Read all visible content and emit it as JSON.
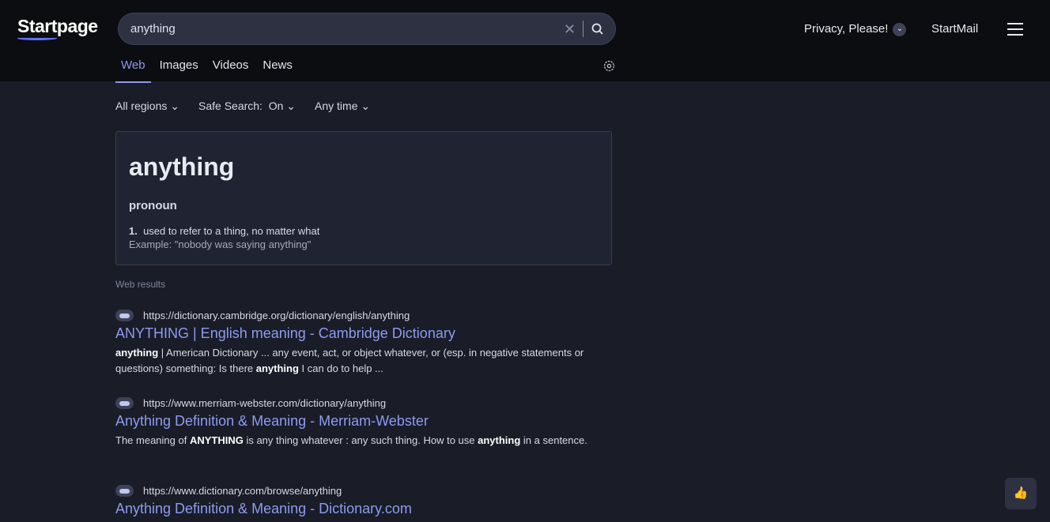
{
  "header": {
    "logo": "Startpage",
    "query": "anything",
    "privacy": "Privacy, Please!",
    "startmail": "StartMail"
  },
  "tabs": [
    "Web",
    "Images",
    "Videos",
    "News"
  ],
  "filters": {
    "region": "All regions",
    "safe_label": "Safe Search:",
    "safe_value": "On",
    "time": "Any time"
  },
  "definition": {
    "word": "anything",
    "pos": "pronoun",
    "num": "1.",
    "def": "used to refer to a thing, no matter what",
    "example": "Example: \"nobody was saying anything\""
  },
  "web_results_label": "Web results",
  "results": [
    {
      "url": "https://dictionary.cambridge.org/dictionary/english/anything",
      "title": "ANYTHING | English meaning - Cambridge Dictionary",
      "snippet": [
        {
          "t": "anything",
          "b": true
        },
        {
          "t": " | American Dictionary ... any event, act, or object whatever, or (esp. in negative statements or questions) something: Is there "
        },
        {
          "t": "anything",
          "b": true
        },
        {
          "t": " I can do to help ..."
        }
      ]
    },
    {
      "url": "https://www.merriam-webster.com/dictionary/anything",
      "title": "Anything Definition & Meaning - Merriam-Webster",
      "snippet": [
        {
          "t": "The meaning of "
        },
        {
          "t": "ANYTHING",
          "b": true
        },
        {
          "t": " is any thing whatever : any such thing. How to use "
        },
        {
          "t": "anything",
          "b": true
        },
        {
          "t": " in a sentence."
        }
      ]
    },
    {
      "url": "https://www.dictionary.com/browse/anything",
      "title": "Anything Definition & Meaning - Dictionary.com",
      "snippet": []
    }
  ],
  "colors": {
    "accent": "#8e9bf0",
    "header_bg": "#0c0d10",
    "body_bg": "#1a1c27"
  }
}
